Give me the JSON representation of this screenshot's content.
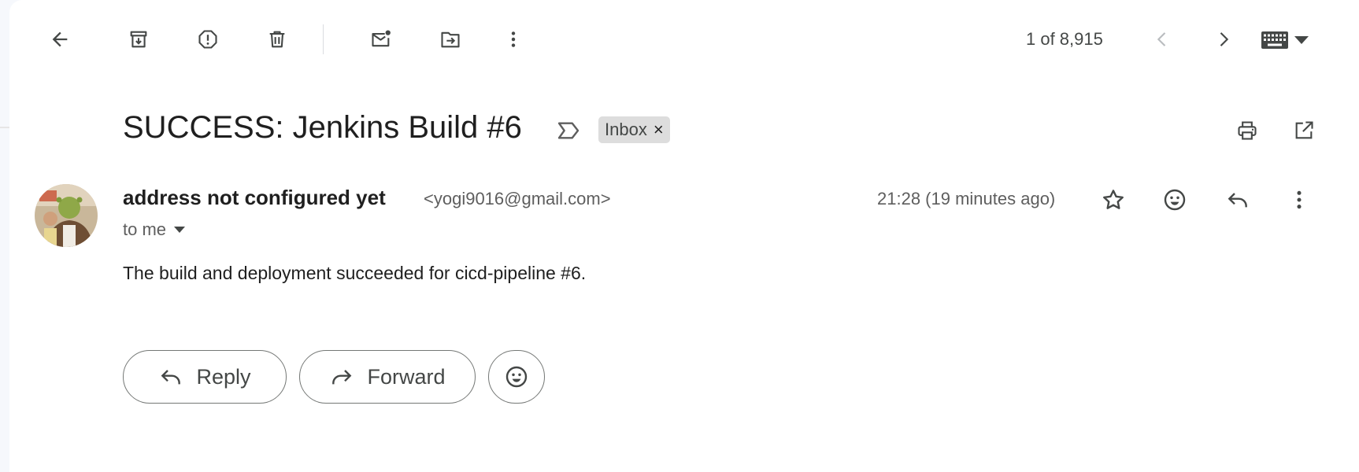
{
  "toolbar": {
    "icons": [
      "back-arrow-icon",
      "archive-icon",
      "report-spam-icon",
      "delete-icon",
      "mark-unread-icon",
      "move-to-icon",
      "more-vert-icon"
    ],
    "counter": "1 of 8,915",
    "nav": [
      "chevron-left-icon",
      "chevron-right-icon"
    ],
    "input_tool": "keyboard-icon"
  },
  "subject": {
    "title": "SUCCESS: Jenkins Build #6",
    "label": "Inbox",
    "label_remove": "×"
  },
  "message": {
    "sender_name": "address not configured yet",
    "sender_email": "<yogi9016@gmail.com>",
    "recipient": "to me",
    "timestamp": "21:28 (19 minutes ago)",
    "body": "The build and deployment succeeded for cicd-pipeline #6."
  },
  "actions": {
    "reply": "Reply",
    "forward": "Forward"
  },
  "colors": {
    "page_bg": "#f6f8fc",
    "card_bg": "#ffffff",
    "icon": "#444746",
    "chip_bg": "#dddddd",
    "muted_text": "#5e5e5e"
  }
}
